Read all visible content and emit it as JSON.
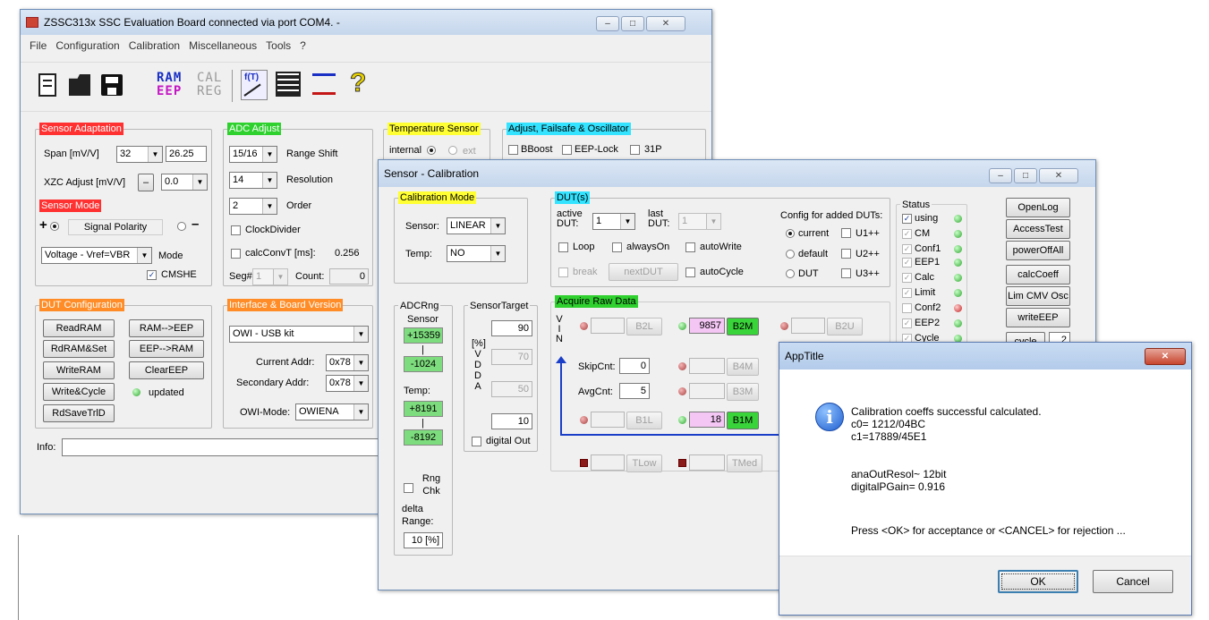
{
  "main": {
    "title": "ZSSC313x SSC Evaluation Board connected via port COM4. -",
    "menu": [
      "File",
      "Configuration",
      "Calibration",
      "Miscellaneous",
      "Tools",
      "?"
    ],
    "toolbar": {
      "ram": "RAM",
      "eep": "EEP",
      "cal": "CAL",
      "reg": "REG"
    },
    "sensor_adaptation": {
      "title": "Sensor Adaptation",
      "span_label": "Span [mV/V]",
      "span_value": "32",
      "span_result": "26.25",
      "xzc_label": "XZC Adjust [mV/V]",
      "xzc_minus": "–",
      "xzc_value": "0.0"
    },
    "sensor_mode": {
      "title": "Sensor Mode",
      "plus": "+",
      "signal_polarity": "Signal Polarity",
      "minus": "–",
      "mode_value": "Voltage - Vref=VBR",
      "mode_label": "Mode",
      "cmshe": "CMSHE"
    },
    "adc_adjust": {
      "title": "ADC Adjust",
      "range_value": "15/16",
      "range_label": "Range Shift",
      "res_value": "14",
      "res_label": "Resolution",
      "order_value": "2",
      "order_label": "Order",
      "clockdivider": "ClockDivider",
      "calcconv_label": "calcConvT  [ms]:",
      "calcconv_value": "0.256",
      "seg_label": "Seg#",
      "seg_value": "1",
      "count_label": "Count:",
      "count_value": "0"
    },
    "temperature_sensor": {
      "title": "Temperature Sensor",
      "internal": "internal",
      "ext": "ext"
    },
    "adjust_failsafe": {
      "title": "Adjust, Failsafe & Oscillator",
      "bboost": "BBoost",
      "eeplock": "EEP-Lock",
      "p31": "31P"
    },
    "dut_config": {
      "title": "DUT Configuration",
      "readram": "ReadRAM",
      "ram_eep": "RAM-->EEP",
      "rdramset": "RdRAM&Set",
      "eep_ram": "EEP-->RAM",
      "writeram": "WriteRAM",
      "cleareep": "ClearEEP",
      "writecycle": "Write&Cycle",
      "updated": "updated",
      "rdsave": "RdSaveTrlD"
    },
    "interface": {
      "title": "Interface & Board Version",
      "board": "OWI  - USB kit",
      "current_addr_label": "Current Addr:",
      "current_addr": "0x78",
      "secondary_addr_label": "Secondary Addr:",
      "secondary_addr": "0x78",
      "owi_mode_label": "OWI-Mode:",
      "owi_mode": "OWIENA"
    },
    "info_label": "Info:"
  },
  "cal": {
    "title": "Sensor - Calibration",
    "calibration_mode": {
      "title": "Calibration Mode",
      "sensor_label": "Sensor:",
      "sensor_value": "LINEAR",
      "temp_label": "Temp:",
      "temp_value": "NO"
    },
    "duts": {
      "title": "DUT(s)",
      "active_label1": "active",
      "active_label2": "DUT:",
      "active_value": "1",
      "last_label1": "last",
      "last_label2": "DUT:",
      "last_value": "1",
      "config_label": "Config for added DUTs:",
      "loop": "Loop",
      "alwayson": "alwaysOn",
      "autowrite": "autoWrite",
      "break": "break",
      "nextdut": "nextDUT",
      "autocycle": "autoCycle",
      "current": "current",
      "default": "default",
      "dut": "DUT",
      "u1": "U1++",
      "u2": "U2++",
      "u3": "U3++"
    },
    "status": {
      "title": "Status",
      "items": [
        "using",
        "CM",
        "Conf1",
        "EEP1",
        "Calc",
        "Limit",
        "Conf2",
        "EEP2",
        "Cycle"
      ]
    },
    "buttons": {
      "openlog": "OpenLog",
      "accesstest": "AccessTest",
      "poweroffall": "powerOffAll",
      "calccoeff": "calcCoeff",
      "limcmvosc": "Lim CMV Osc",
      "writeeep": "writeEEP",
      "cycle": "cycle",
      "cycle_value": "2"
    },
    "adcrng": {
      "title": "ADCRng",
      "sensor_label": "Sensor",
      "sensor_max": "+15359",
      "sep": "|",
      "sensor_min": "-1024",
      "temp_label": "Temp:",
      "temp_max": "+8191",
      "temp_min": "-8192",
      "rng_chk": "Rng Chk",
      "delta_label": "delta Range:",
      "delta_value": "10 [%]"
    },
    "sensortarget": {
      "title": "SensorTarget",
      "v90": "90",
      "vdda": "[%] V D D A",
      "v70": "70",
      "v50": "50",
      "v10": "10",
      "digital_out": "digital Out"
    },
    "acquire": {
      "title": "Acquire Raw Data",
      "vin": "V I N",
      "b2l": "B2L",
      "b2m_value": "9857",
      "b2m": "B2M",
      "b2u": "B2U",
      "skipcnt_label": "SkipCnt:",
      "skipcnt": "0",
      "b4m": "B4M",
      "avgcnt_label": "AvgCnt:",
      "avgcnt": "5",
      "b3m": "B3M",
      "b1l": "B1L",
      "b1m_value": "18",
      "b1m": "B1M",
      "tlow": "TLow",
      "tmed": "TMed"
    }
  },
  "dialog": {
    "title": "AppTitle",
    "line1": "Calibration coeffs successful calculated.",
    "line2": "c0= 1212/04BC",
    "line3": "c1=17889/45E1",
    "line4": "anaOutResol~ 12bit",
    "line5": "digitalPGain=  0.916",
    "prompt": "Press <OK> for acceptance or <CANCEL> for rejection ...",
    "ok": "OK",
    "cancel": "Cancel",
    "info_glyph": "i"
  }
}
